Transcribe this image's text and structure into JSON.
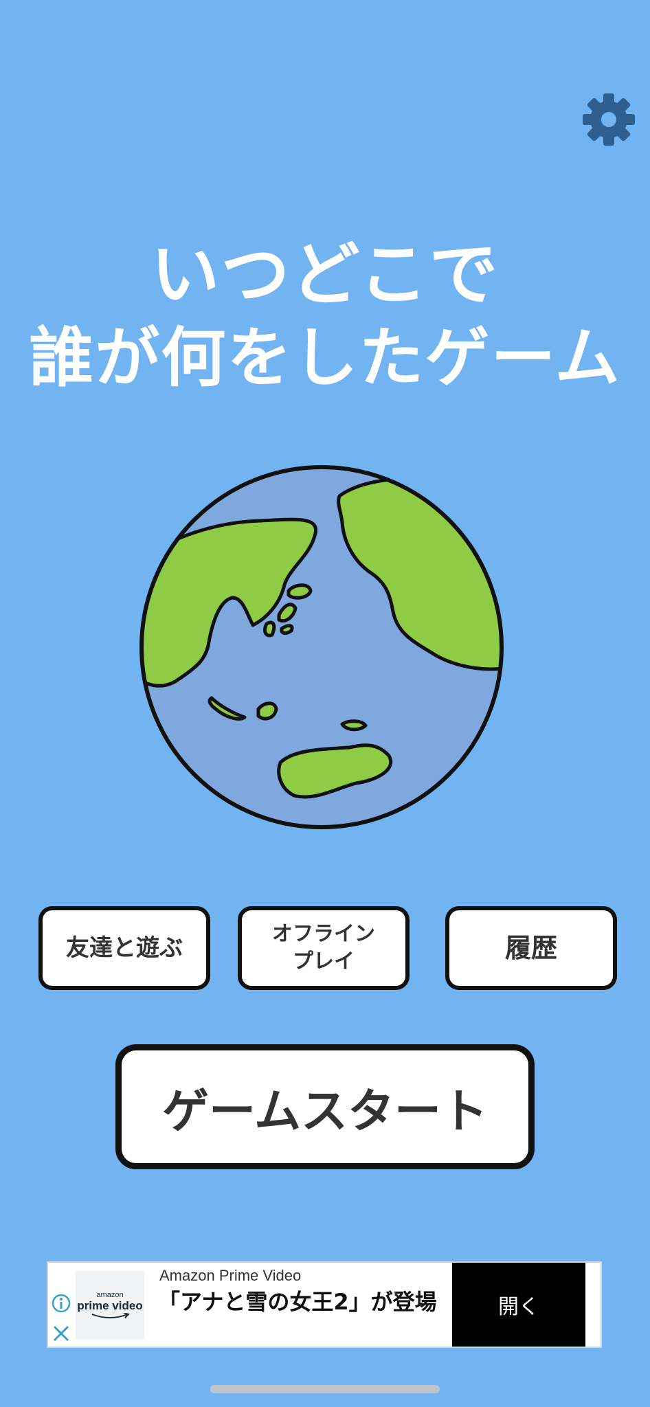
{
  "settings": {
    "icon": "gear-icon"
  },
  "title": {
    "line1": "いつどこで",
    "line2": "誰が何をしたゲーム"
  },
  "illustration": {
    "icon": "earth-globe"
  },
  "menu": {
    "friends_label": "友達と遊ぶ",
    "offline_label_line1": "オフライン",
    "offline_label_line2": "プレイ",
    "history_label": "履歴"
  },
  "start_button": {
    "label": "ゲームスタート"
  },
  "ad": {
    "logo_line1": "amazon",
    "logo_line2": "prime video",
    "sponsor": "Amazon Prime Video",
    "headline": "「アナと雪の女王2」が登場",
    "cta": "開く"
  },
  "colors": {
    "background": "#72b4f2",
    "button_bg": "#ffffff",
    "button_border": "#111111",
    "gear": "#2f5f8e",
    "land": "#8fcb45",
    "ocean": "#7fa9de"
  }
}
